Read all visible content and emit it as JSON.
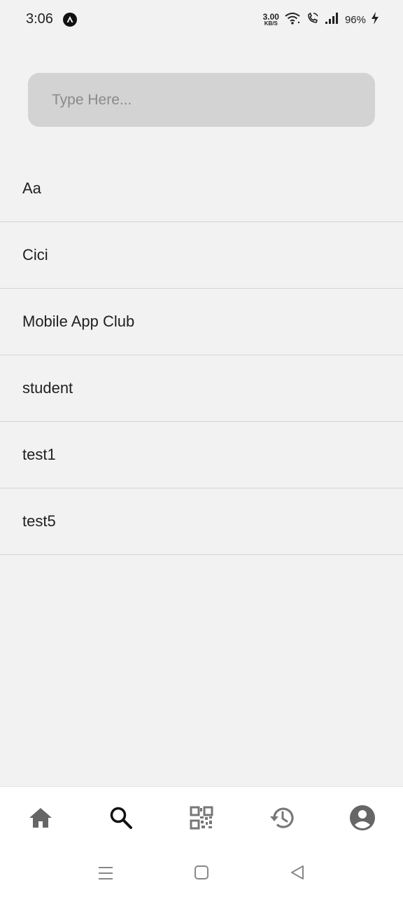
{
  "status_bar": {
    "time": "3:06",
    "net_speed_value": "3.00",
    "net_speed_unit": "KB/S",
    "battery": "96%"
  },
  "search": {
    "placeholder": "Type Here..."
  },
  "list": {
    "items": [
      {
        "label": "Aa"
      },
      {
        "label": "Cici"
      },
      {
        "label": "Mobile App Club"
      },
      {
        "label": "student"
      },
      {
        "label": "test1"
      },
      {
        "label": "test5"
      }
    ]
  },
  "bottom_nav": {
    "items": [
      {
        "icon": "home-icon",
        "color": "#666666"
      },
      {
        "icon": "search-icon",
        "color": "#111111",
        "active": true
      },
      {
        "icon": "qr-code-icon",
        "color": "#777777"
      },
      {
        "icon": "history-icon",
        "color": "#777777"
      },
      {
        "icon": "account-icon",
        "color": "#666666"
      }
    ]
  },
  "colors": {
    "background": "#f2f2f2",
    "search_bg": "#d3d3d3",
    "divider": "#d6d6d6",
    "nav_bg": "#ffffff"
  }
}
